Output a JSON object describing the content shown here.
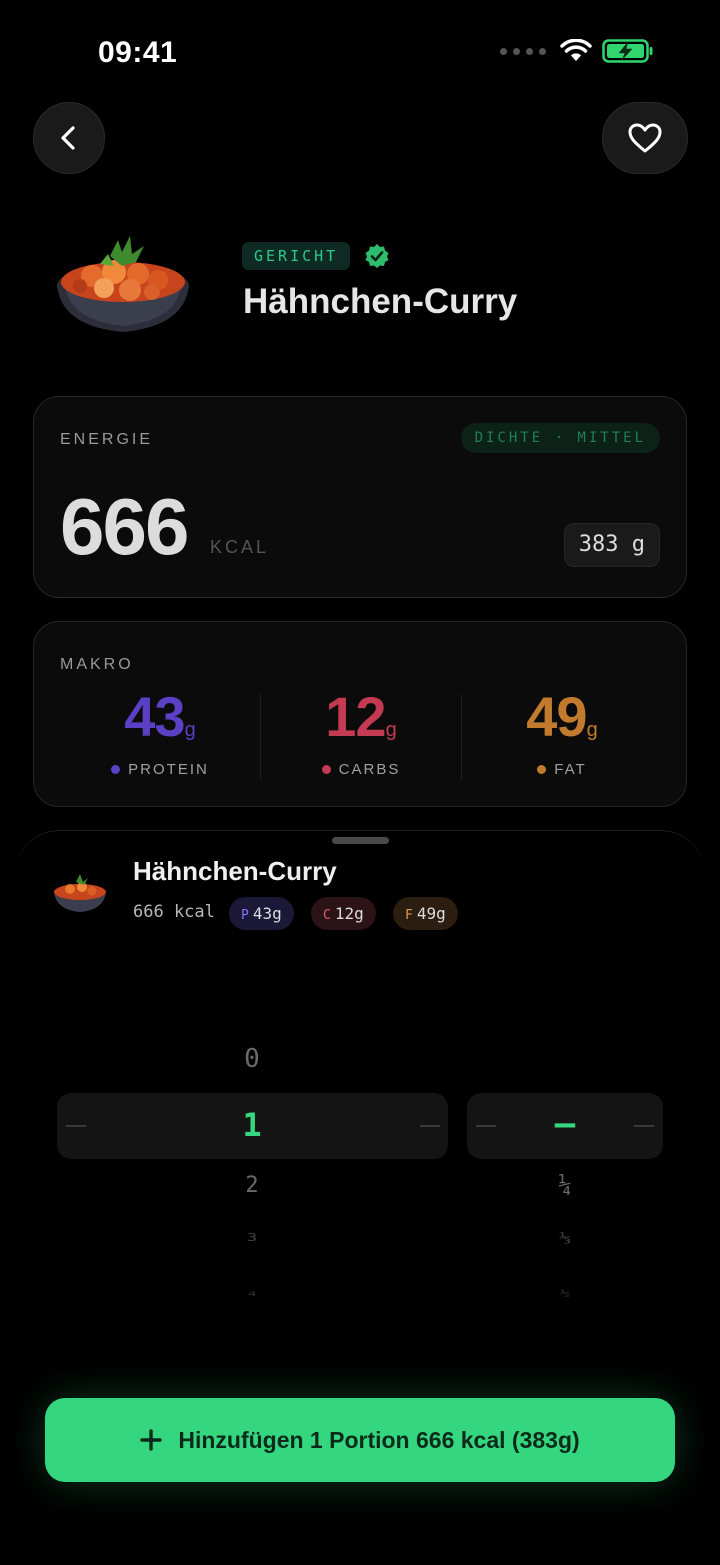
{
  "status": {
    "time": "09:41"
  },
  "food": {
    "tag": "GERICHT",
    "title": "Hähnchen-Curry"
  },
  "energy": {
    "label": "ENERGIE",
    "density": "DICHTE · MITTEL",
    "kcal": "666",
    "unit": "KCAL",
    "weight": "383 g"
  },
  "macros": {
    "label": "MAKRO",
    "items": [
      {
        "value": "43",
        "unit": "g",
        "label": "PROTEIN",
        "color": "#5b3fc4"
      },
      {
        "value": "12",
        "unit": "g",
        "label": "CARBS",
        "color": "#c43a52"
      },
      {
        "value": "49",
        "unit": "g",
        "label": "FAT",
        "color": "#c27a2c"
      }
    ]
  },
  "sheet": {
    "title": "Hähnchen-Curry",
    "kcal": "666 kcal",
    "pills": [
      {
        "key": "P",
        "value": "43g",
        "bg": "#1b1838",
        "keycolor": "#8a70ff"
      },
      {
        "key": "C",
        "value": "12g",
        "bg": "#2b1318",
        "keycolor": "#e05a6e"
      },
      {
        "key": "F",
        "value": "49g",
        "bg": "#2b1d0f",
        "keycolor": "#e09a4a"
      }
    ]
  },
  "picker": {
    "amounts": [
      "0",
      "1",
      "2",
      "3",
      "4"
    ],
    "selected_amount": "1",
    "fractions": [
      "–",
      "¼",
      "⅓",
      "½"
    ]
  },
  "cta": {
    "label": "Hinzufügen 1 Portion 666 kcal (383g)"
  }
}
